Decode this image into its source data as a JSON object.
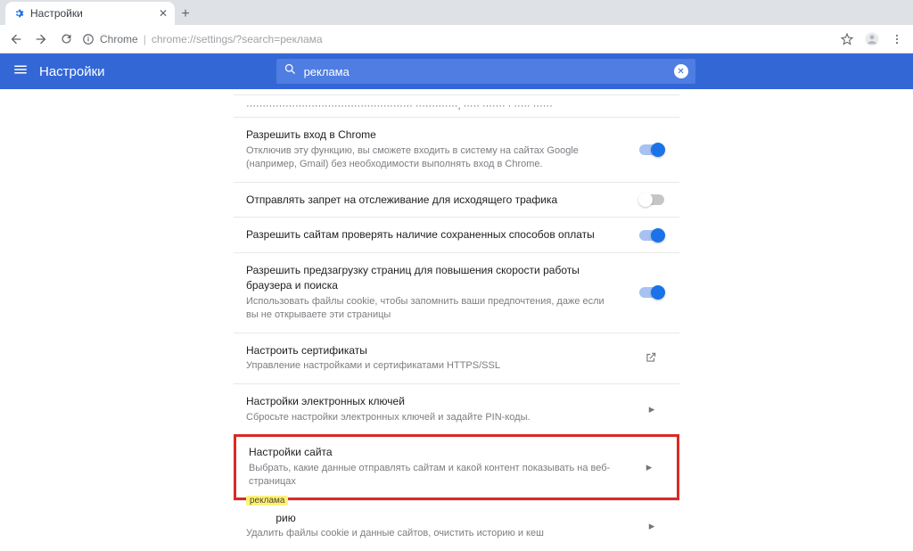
{
  "window": {
    "tab_title": "Настройки",
    "new_tab": "+"
  },
  "toolbar": {
    "host_label": "Chrome",
    "url_path": "chrome://settings/?search=реклама"
  },
  "header": {
    "title": "Настройки"
  },
  "search": {
    "value": "реклама"
  },
  "rows": {
    "truncated": "··················································· ·············, ····· ······· · ····· ······",
    "login_chrome": {
      "title": "Разрешить вход в Chrome",
      "desc": "Отключив эту функцию, вы сможете входить в систему на сайтах Google (например, Gmail) без необходимости выполнять вход в Chrome."
    },
    "dnt": {
      "title": "Отправлять запрет на отслеживание для исходящего трафика"
    },
    "payment": {
      "title": "Разрешить сайтам проверять наличие сохраненных способов оплаты"
    },
    "preload": {
      "title": "Разрешить предзагрузку страниц для повышения скорости работы браузера и поиска",
      "desc": "Использовать файлы cookie, чтобы запомнить ваши предпочтения, даже если вы не открываете эти страницы"
    },
    "certs": {
      "title": "Настроить сертификаты",
      "desc": "Управление настройками и сертификатами HTTPS/SSL"
    },
    "keys": {
      "title": "Настройки электронных ключей",
      "desc": "Сбросьте настройки электронных ключей и задайте PIN-коды."
    },
    "site": {
      "title": "Настройки сайта",
      "desc": "Выбрать, какие данные отправлять сайтам и какой контент показывать на веб-страницах"
    },
    "clear": {
      "chip": "реклама",
      "title_suffix": "       рию",
      "desc": "Удалить файлы cookie и данные сайтов, очистить историю и кеш"
    }
  }
}
